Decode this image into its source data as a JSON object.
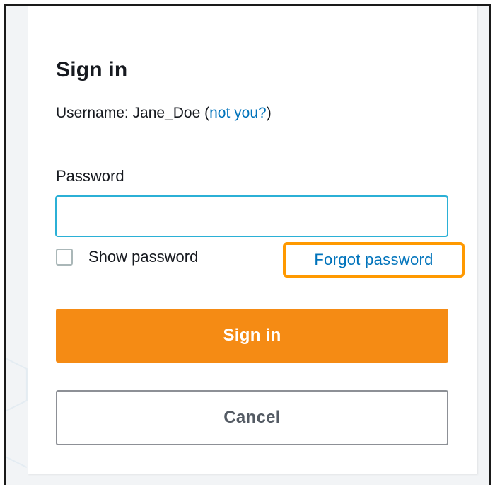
{
  "signin": {
    "title": "Sign in",
    "username_prefix": "Username: ",
    "username": "Jane_Doe",
    "open_paren": " (",
    "not_you_link": "not you?",
    "close_paren": ")",
    "password_label": "Password",
    "password_value": "",
    "show_password_label": "Show password",
    "show_password_checked": false,
    "forgot_password_link": "Forgot password",
    "signin_button": "Sign in",
    "cancel_button": "Cancel"
  },
  "colors": {
    "primary_button": "#f58b14",
    "link": "#0073bb",
    "highlight": "#ff9900",
    "input_focus": "#2bb0d6"
  }
}
